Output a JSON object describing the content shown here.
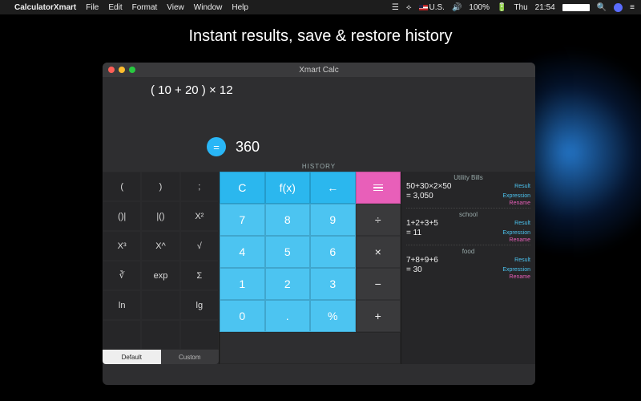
{
  "menubar": {
    "app_name": "CalculatorXmart",
    "menus": [
      "File",
      "Edit",
      "Format",
      "View",
      "Window",
      "Help"
    ],
    "right": {
      "locale": "U.S.",
      "volume_label": "100%",
      "day": "Thu",
      "time": "21:54"
    }
  },
  "headline": "Instant results, save & restore history",
  "window": {
    "title": "Xmart Calc",
    "expression": "( 10 + 20 ) × 12",
    "equals_glyph": "=",
    "result": "360",
    "history_label": "HISTORY"
  },
  "adv_keys": [
    "(",
    ")",
    ";",
    "()|",
    "|()",
    "X²",
    "X³",
    "X^",
    "√",
    "∛",
    "exp",
    "Σ",
    "ln",
    "",
    "lg"
  ],
  "adv_tabs": {
    "default": "Default",
    "custom": "Custom"
  },
  "keypad": {
    "C": "C",
    "fx": "f(x)",
    "back": "←",
    "n7": "7",
    "n8": "8",
    "n9": "9",
    "div": "÷",
    "n4": "4",
    "n5": "5",
    "n6": "6",
    "mul": "×",
    "n1": "1",
    "n2": "2",
    "n3": "3",
    "sub": "−",
    "n0": "0",
    "dot": ".",
    "pct": "%",
    "add": "+"
  },
  "history": [
    {
      "title": "Utility Bills",
      "expr": "50+30×2×50",
      "result": "=  3,050"
    },
    {
      "title": "school",
      "expr": "1+2+3+5",
      "result": "=  11"
    },
    {
      "title": "food",
      "expr": "7+8+9+6",
      "result": "=  30"
    }
  ],
  "hist_actions": {
    "result": "Result",
    "expression": "Expression",
    "rename": "Rename"
  }
}
